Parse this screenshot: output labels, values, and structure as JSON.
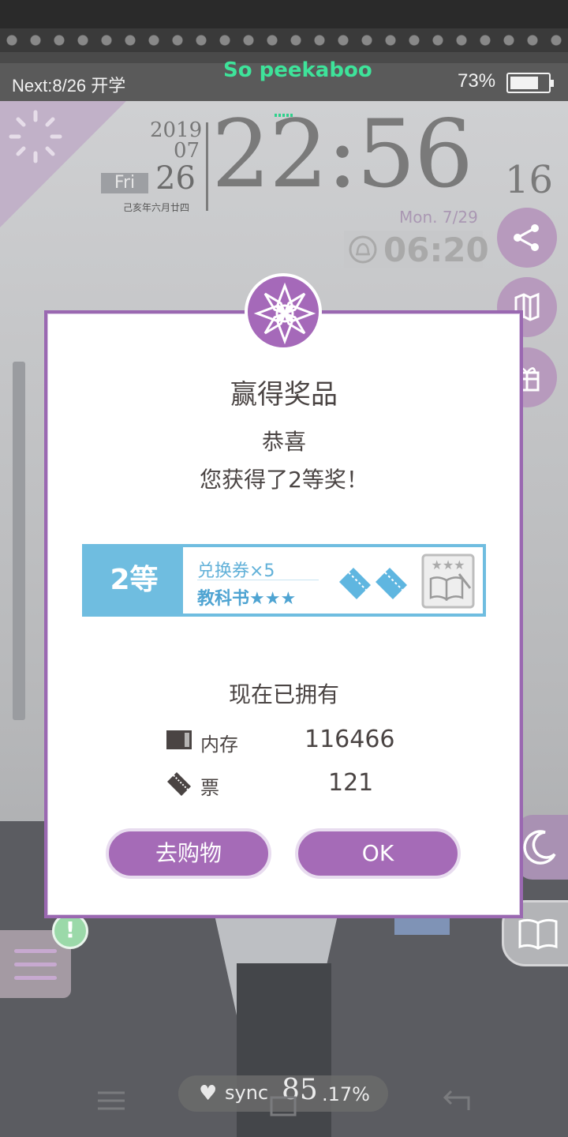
{
  "status_bar": {
    "next_event": "Next:8/26 开学",
    "song_title": "So peekaboo",
    "battery_percent": "73%",
    "battery_level": 0.73
  },
  "clock": {
    "year": "2019",
    "month": "07",
    "day_of_week": "Fri",
    "day": "26",
    "lunar_date": "己亥年六月廿四",
    "time": "22:56",
    "seconds": "16",
    "next_alarm_date": "Mon.  7/29",
    "alarm_time": "06:20"
  },
  "side_buttons": {
    "icons": [
      "share-icon",
      "map-icon",
      "gift-icon",
      "moon-icon",
      "book-icon",
      "menu-icon"
    ]
  },
  "alert": {
    "glyph": "!"
  },
  "modal": {
    "title": "赢得奖品",
    "congrats": "恭喜",
    "prize_message": "您获得了2等奖！",
    "prize_card": {
      "rank": "2等",
      "item1": "兑换券×5",
      "item2": "教科书★★★"
    },
    "owned_title": "现在已拥有",
    "owned": [
      {
        "icon": "memory-icon",
        "label": "内存",
        "value": "116466"
      },
      {
        "icon": "ticket-icon",
        "label": "票",
        "value": "121"
      }
    ],
    "shop_button": "去购物",
    "ok_button": "OK"
  },
  "sync": {
    "label": "sync.",
    "value": "85",
    "decimal": ".17%"
  },
  "colors": {
    "accent_purple": "#a56bb7",
    "prize_blue": "#6fbde0",
    "song_green": "#3ee39a"
  }
}
